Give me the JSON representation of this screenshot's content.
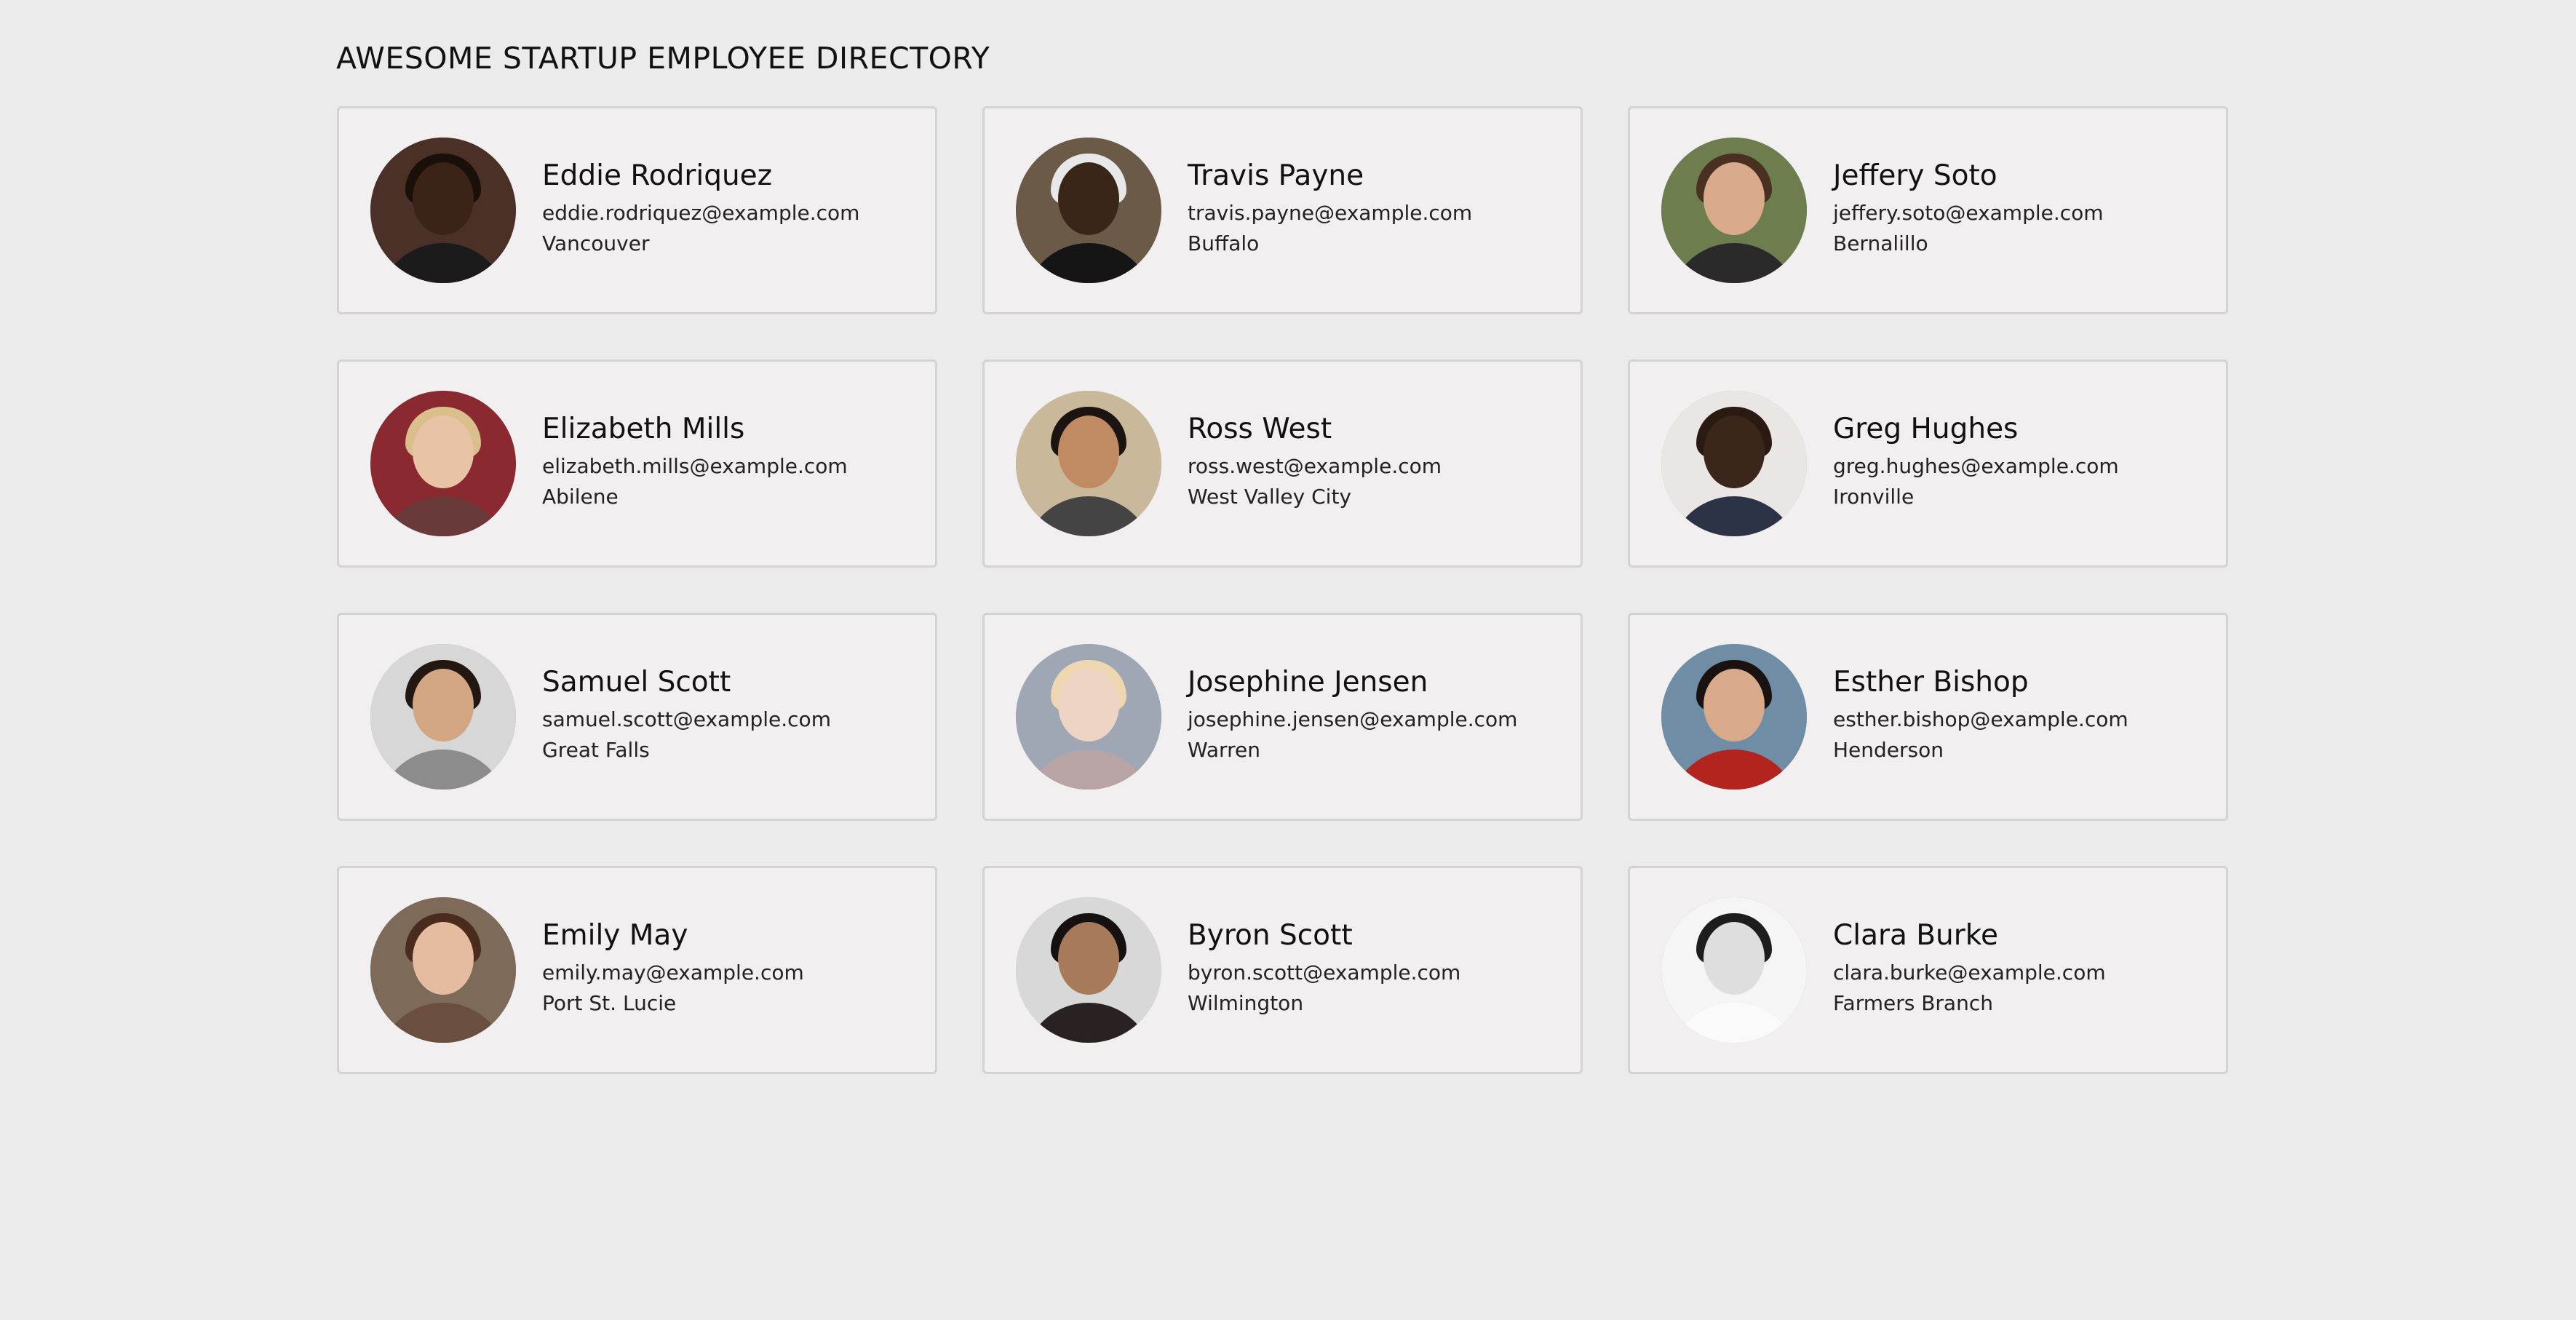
{
  "header": {
    "title": "AWESOME STARTUP EMPLOYEE DIRECTORY"
  },
  "employees": [
    {
      "name": "Eddie Rodriquez",
      "email": "eddie.rodriquez@example.com",
      "city": "Vancouver",
      "avatar": {
        "bg": "#4a3026",
        "skin": "#3b2417",
        "hair": "#1a100a",
        "shirt": "#1b1b1b"
      }
    },
    {
      "name": "Travis Payne",
      "email": "travis.payne@example.com",
      "city": "Buffalo",
      "avatar": {
        "bg": "#6b5a48",
        "skin": "#3a2618",
        "hair": "#e8e8e8",
        "shirt": "#151515"
      }
    },
    {
      "name": "Jeffery Soto",
      "email": "jeffery.soto@example.com",
      "city": "Bernalillo",
      "avatar": {
        "bg": "#6e7d4e",
        "skin": "#d9ab8c",
        "hair": "#4a3020",
        "shirt": "#2a2a2a"
      }
    },
    {
      "name": "Elizabeth Mills",
      "email": "elizabeth.mills@example.com",
      "city": "Abilene",
      "avatar": {
        "bg": "#8a2a30",
        "skin": "#e8c3a5",
        "hair": "#d9bf8c",
        "shirt": "#6a3a3a"
      }
    },
    {
      "name": "Ross West",
      "email": "ross.west@example.com",
      "city": "West Valley City",
      "avatar": {
        "bg": "#c9b89a",
        "skin": "#c08a62",
        "hair": "#1b1410",
        "shirt": "#444"
      }
    },
    {
      "name": "Greg Hughes",
      "email": "greg.hughes@example.com",
      "city": "Ironville",
      "avatar": {
        "bg": "#e9e6e3",
        "skin": "#3b261b",
        "hair": "#2a1a12",
        "shirt": "#2c3347"
      }
    },
    {
      "name": "Samuel Scott",
      "email": "samuel.scott@example.com",
      "city": "Great Falls",
      "avatar": {
        "bg": "#d7d7d7",
        "skin": "#d2a583",
        "hair": "#231712",
        "shirt": "#8c8c8c"
      }
    },
    {
      "name": "Josephine Jensen",
      "email": "josephine.jensen@example.com",
      "city": "Warren",
      "avatar": {
        "bg": "#9fa7b4",
        "skin": "#eed4c4",
        "hair": "#efd7b1",
        "shirt": "#b8a4a4"
      }
    },
    {
      "name": "Esther Bishop",
      "email": "esther.bishop@example.com",
      "city": "Henderson",
      "avatar": {
        "bg": "#6f8ea5",
        "skin": "#d8a98a",
        "hair": "#1a1210",
        "shirt": "#b3241f"
      }
    },
    {
      "name": "Emily May",
      "email": "emily.may@example.com",
      "city": "Port St. Lucie",
      "avatar": {
        "bg": "#7d6a58",
        "skin": "#e5bca0",
        "hair": "#4a2c1c",
        "shirt": "#6b4f3e"
      }
    },
    {
      "name": "Byron Scott",
      "email": "byron.scott@example.com",
      "city": "Wilmington",
      "avatar": {
        "bg": "#d8d8d8",
        "skin": "#a77a5a",
        "hair": "#161010",
        "shirt": "#2a2222"
      }
    },
    {
      "name": "Clara Burke",
      "email": "clara.burke@example.com",
      "city": "Farmers Branch",
      "avatar": {
        "bg": "#f5f5f5",
        "skin": "#dedede",
        "hair": "#1d1d1d",
        "shirt": "#fafafa"
      }
    }
  ]
}
